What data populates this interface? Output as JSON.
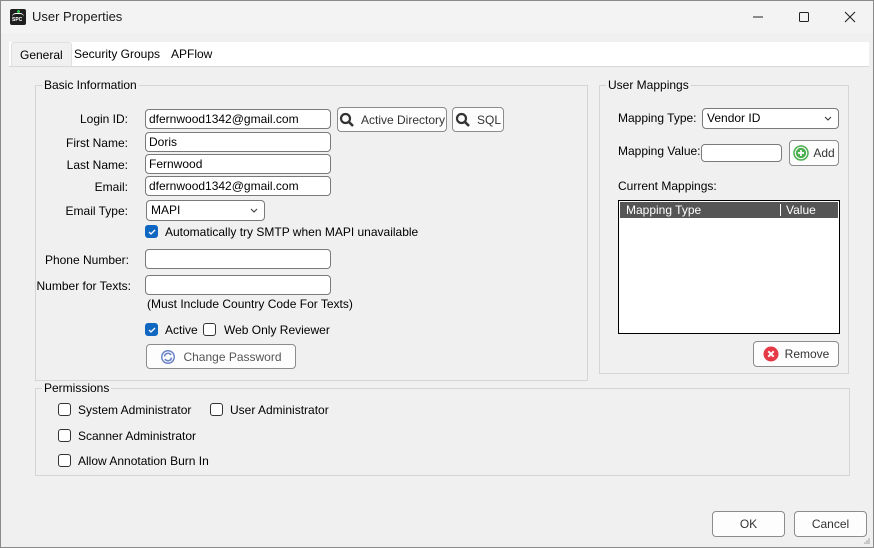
{
  "window": {
    "title": "User Properties",
    "app_icon": "spc-logo-icon",
    "controls": {
      "minimize": "minimize-icon",
      "maximize": "maximize-icon",
      "close": "close-icon"
    }
  },
  "tabs": [
    {
      "label": "General",
      "active": true
    },
    {
      "label": "Security Groups",
      "active": false
    },
    {
      "label": "APFlow",
      "active": false
    }
  ],
  "basic_info": {
    "group_label": "Basic Information",
    "login_id": {
      "label": "Login ID:",
      "value": "dfernwood1342@gmail.com"
    },
    "first_name": {
      "label": "First Name:",
      "value": "Doris"
    },
    "last_name": {
      "label": "Last Name:",
      "value": "Fernwood"
    },
    "email": {
      "label": "Email:",
      "value": "dfernwood1342@gmail.com"
    },
    "email_type": {
      "label": "Email Type:",
      "value": "MAPI"
    },
    "auto_smtp": {
      "label": "Automatically try SMTP when MAPI unavailable",
      "checked": true
    },
    "phone": {
      "label": "Phone Number:",
      "value": ""
    },
    "texts": {
      "label": "Number for Texts:",
      "value": "",
      "hint": "(Must Include Country Code For Texts)"
    },
    "active": {
      "label": "Active",
      "checked": true
    },
    "web_only": {
      "label": "Web Only Reviewer",
      "checked": false
    },
    "active_directory_button": "Active Directory",
    "sql_button": "SQL",
    "change_password_button": "Change Password"
  },
  "user_mappings": {
    "group_label": "User Mappings",
    "mapping_type": {
      "label": "Mapping Type:",
      "value": "Vendor ID"
    },
    "mapping_value": {
      "label": "Mapping Value:",
      "value": ""
    },
    "add_button": "Add",
    "current_label": "Current Mappings:",
    "columns": [
      "Mapping Type",
      "Value"
    ],
    "rows": [],
    "remove_button": "Remove"
  },
  "permissions": {
    "group_label": "Permissions",
    "items": [
      {
        "label": "System Administrator",
        "checked": false
      },
      {
        "label": "User Administrator",
        "checked": false
      },
      {
        "label": "Scanner Administrator",
        "checked": false
      },
      {
        "label": "Allow Annotation Burn In",
        "checked": false
      }
    ]
  },
  "footer": {
    "ok": "OK",
    "cancel": "Cancel"
  },
  "colors": {
    "accent": "#0f67c2",
    "list_header": "#555555",
    "add_icon": "#4caf50",
    "remove_icon": "#e53945"
  }
}
